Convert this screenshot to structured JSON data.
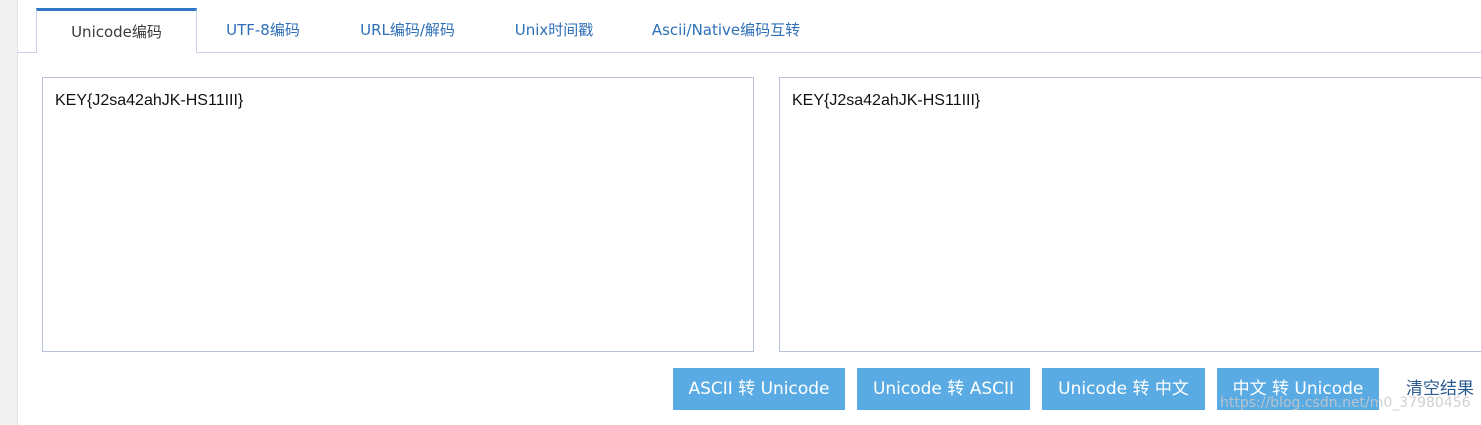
{
  "tabs": [
    {
      "label": "Unicode编码",
      "active": true
    },
    {
      "label": "UTF-8编码",
      "active": false
    },
    {
      "label": "URL编码/解码",
      "active": false
    },
    {
      "label": "Unix时间戳",
      "active": false
    },
    {
      "label": "Ascii/Native编码互转",
      "active": false
    }
  ],
  "input": {
    "value": "KEY{J2sa42ahJK-HS11III}"
  },
  "output": {
    "value": "KEY{J2sa42ahJK-HS11III}"
  },
  "buttons": {
    "ascii_to_unicode": "ASCII 转 Unicode",
    "unicode_to_ascii": "Unicode 转 ASCII",
    "unicode_to_chinese": "Unicode 转 中文",
    "chinese_to_unicode": "中文 转 Unicode",
    "clear": "清空结果"
  },
  "watermark": "https://blog.csdn.net/m0_37980456",
  "colors": {
    "accent": "#2f78c6",
    "button": "#5aabe4",
    "link": "#2f6fb8"
  }
}
